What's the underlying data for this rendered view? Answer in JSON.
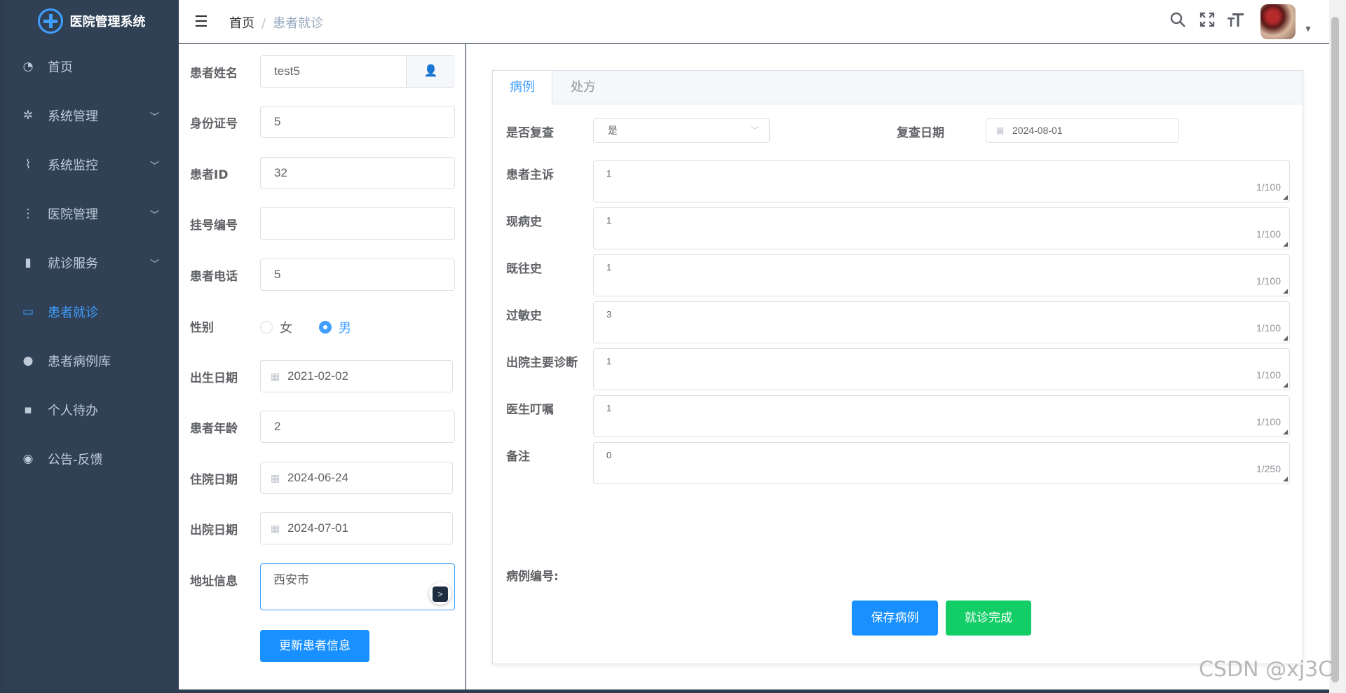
{
  "app": {
    "title": "医院管理系统"
  },
  "sidebar": {
    "items": [
      {
        "label": "首页",
        "icon": "dashboard-icon",
        "glyph": "◔",
        "expandable": false,
        "active": false
      },
      {
        "label": "系统管理",
        "icon": "settings-icon",
        "glyph": "✲",
        "expandable": true,
        "active": false
      },
      {
        "label": "系统监控",
        "icon": "monitor-icon",
        "glyph": "⌇",
        "expandable": true,
        "active": false
      },
      {
        "label": "医院管理",
        "icon": "tree-icon",
        "glyph": "⋮",
        "expandable": true,
        "active": false
      },
      {
        "label": "就诊服务",
        "icon": "book-icon",
        "glyph": "▮",
        "expandable": true,
        "active": false
      },
      {
        "label": "患者就诊",
        "icon": "screen-icon",
        "glyph": "▭",
        "expandable": false,
        "active": true
      },
      {
        "label": "患者病例库",
        "icon": "user-group-icon",
        "glyph": "●",
        "expandable": false,
        "active": false
      },
      {
        "label": "个人待办",
        "icon": "message-icon",
        "glyph": "▪",
        "expandable": false,
        "active": false
      },
      {
        "label": "公告-反馈",
        "icon": "wechat-icon",
        "glyph": "◉",
        "expandable": false,
        "active": false
      }
    ]
  },
  "header": {
    "breadcrumb": {
      "home": "首页",
      "separator": "/",
      "current": "患者就诊"
    }
  },
  "patient_form": {
    "name": {
      "label": "患者姓名",
      "value": "test5"
    },
    "id_card": {
      "label": "身份证号",
      "value": "5"
    },
    "patient_id": {
      "label": "患者ID",
      "value": "32"
    },
    "reg_no": {
      "label": "挂号编号",
      "value": ""
    },
    "phone": {
      "label": "患者电话",
      "value": "5"
    },
    "gender": {
      "label": "性别",
      "female": "女",
      "male": "男",
      "selected": "男"
    },
    "birth": {
      "label": "出生日期",
      "value": "2021-02-02"
    },
    "age": {
      "label": "患者年龄",
      "value": "2"
    },
    "admit": {
      "label": "住院日期",
      "value": "2024-06-24"
    },
    "discharge": {
      "label": "出院日期",
      "value": "2024-07-01"
    },
    "address": {
      "label": "地址信息",
      "value": "西安市"
    },
    "update_label": "更新患者信息"
  },
  "record": {
    "tabs": [
      "病例",
      "处方"
    ],
    "active_tab": "病例",
    "recheck": {
      "label": "是否复查",
      "value": "是"
    },
    "recheck_date": {
      "label": "复查日期",
      "value": "2024-08-01"
    },
    "fields": [
      {
        "label": "患者主诉",
        "value": "1",
        "count": "1/100"
      },
      {
        "label": "现病史",
        "value": "1",
        "count": "1/100"
      },
      {
        "label": "既往史",
        "value": "1",
        "count": "1/100"
      },
      {
        "label": "过敏史",
        "value": "3",
        "count": "1/100"
      },
      {
        "label": "出院主要诊断",
        "value": "1",
        "count": "1/100"
      },
      {
        "label": "医生叮嘱",
        "value": "1",
        "count": "1/100"
      },
      {
        "label": "备注",
        "value": "0",
        "count": "1/250"
      }
    ],
    "record_no_label": "病例编号:",
    "save_label": "保存病例",
    "finish_label": "就诊完成"
  },
  "watermark": "CSDN @xj3C",
  "colors": {
    "sidebar": "#304156",
    "primary": "#1890ff",
    "success": "#13ce66",
    "active_menu": "#409eff"
  }
}
